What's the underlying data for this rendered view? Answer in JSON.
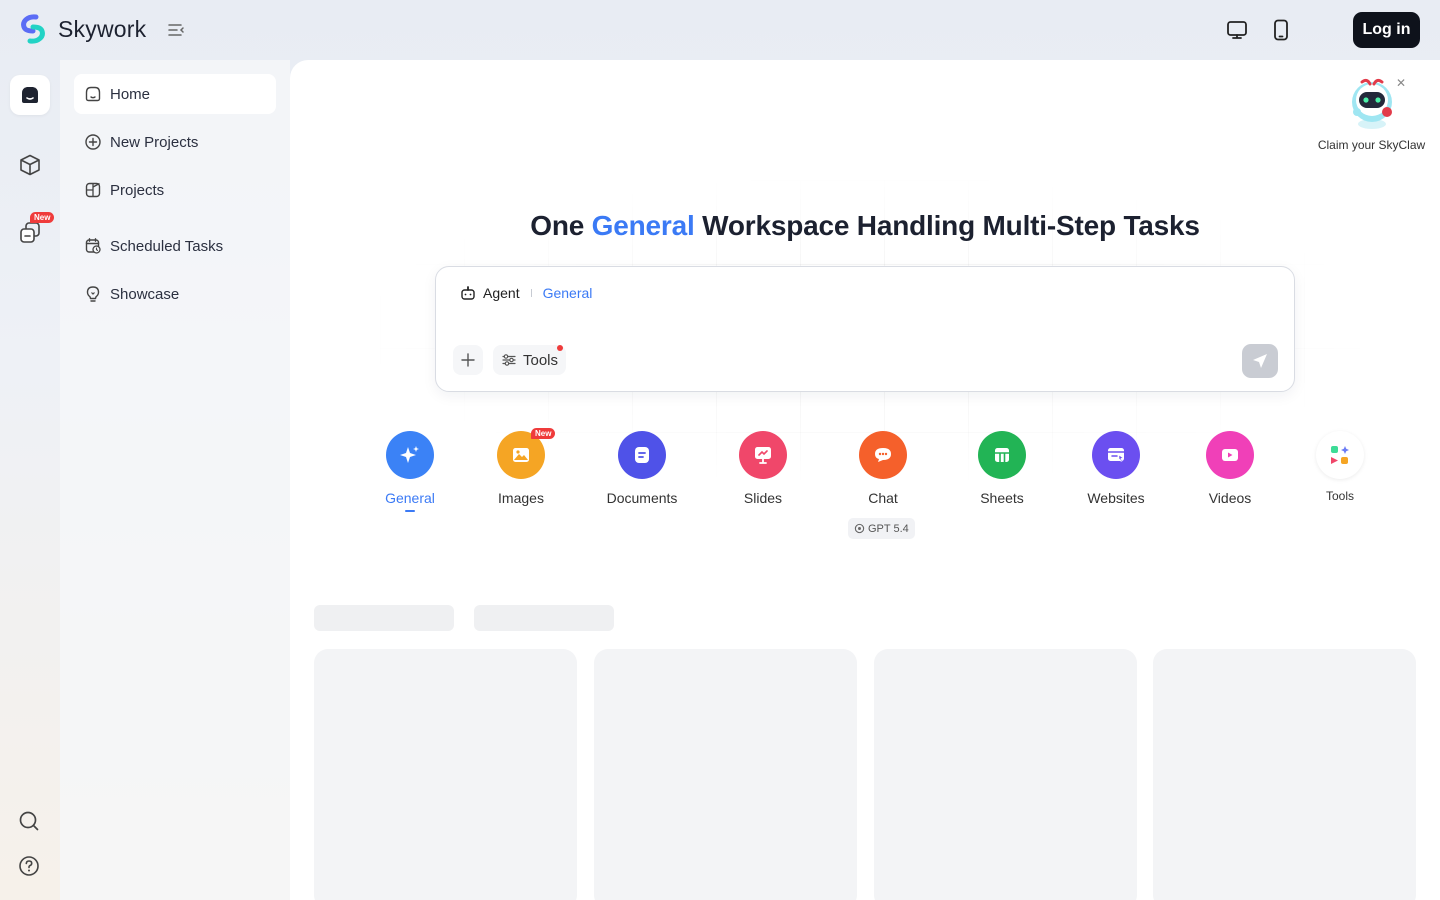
{
  "app": {
    "name": "Skywork"
  },
  "topbar": {
    "login_label": "Log in"
  },
  "sidebar": {
    "rail_badge": "New",
    "items": [
      {
        "label": "Home",
        "icon": "home-icon"
      },
      {
        "label": "New Projects",
        "icon": "plus-circle-icon"
      },
      {
        "label": "Projects",
        "icon": "projects-icon"
      },
      {
        "label": "Scheduled Tasks",
        "icon": "calendar-clock-icon"
      },
      {
        "label": "Showcase",
        "icon": "lightbulb-icon"
      }
    ]
  },
  "hero": {
    "title_prefix": "One ",
    "title_highlight": "General",
    "title_suffix": " Workspace Handling Multi-Step Tasks"
  },
  "composer": {
    "agent_label": "Agent",
    "mode_label": "General",
    "tools_label": "Tools"
  },
  "categories": [
    {
      "label": "General",
      "color": "#3b82f6",
      "icon": "sparkle-icon"
    },
    {
      "label": "Images",
      "color": "#f5a524",
      "icon": "image-icon",
      "badge": "New"
    },
    {
      "label": "Documents",
      "color": "#4f52e8",
      "icon": "document-icon"
    },
    {
      "label": "Slides",
      "color": "#f0476a",
      "icon": "slides-icon"
    },
    {
      "label": "Chat",
      "color": "#f5602b",
      "icon": "chat-icon",
      "chip": "GPT 5.4"
    },
    {
      "label": "Sheets",
      "color": "#22b455",
      "icon": "sheets-icon"
    },
    {
      "label": "Websites",
      "color": "#6b4ff0",
      "icon": "website-icon"
    },
    {
      "label": "Videos",
      "color": "#f040b8",
      "icon": "video-icon"
    },
    {
      "label": "Tools",
      "color": "#ffffff",
      "icon": "tools-grid-icon"
    }
  ],
  "promo": {
    "label": "Claim your SkyClaw"
  },
  "colors": {
    "accent": "#3b7af5",
    "dark_button": "#0e121b",
    "badge": "#ef3b3b"
  }
}
